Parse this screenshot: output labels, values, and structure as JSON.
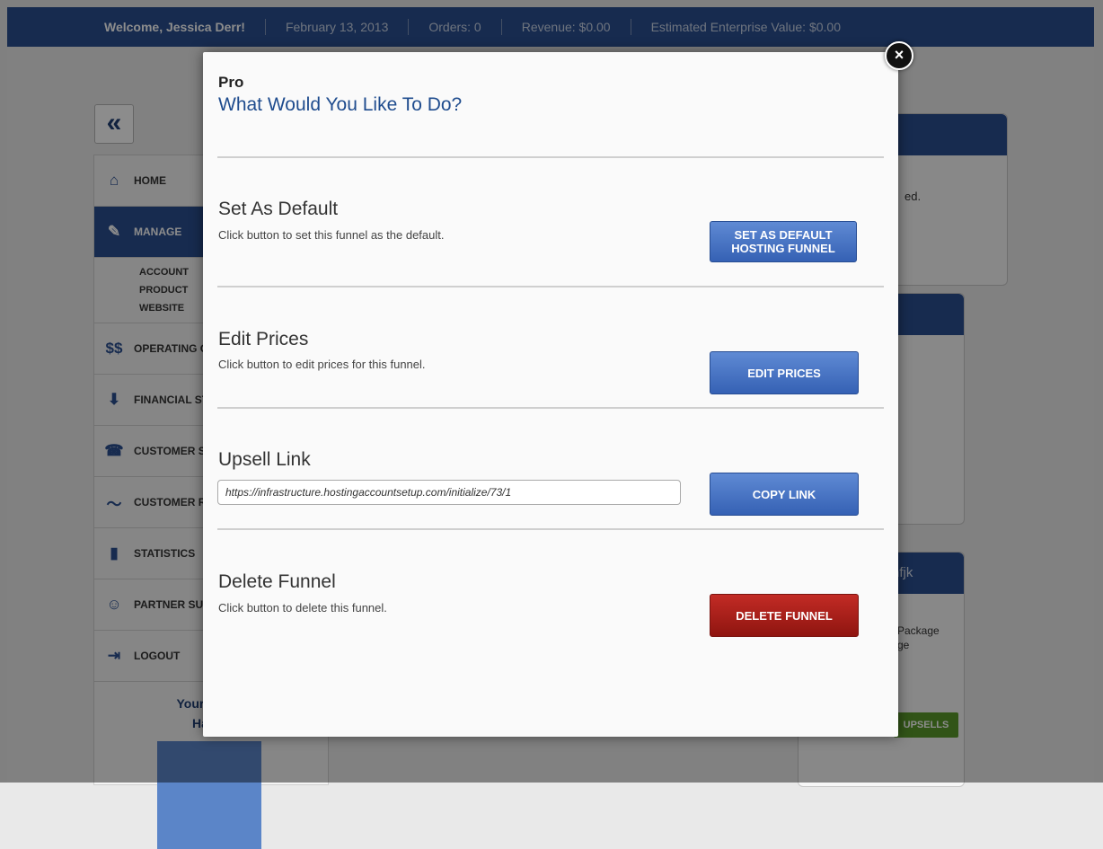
{
  "topbar": {
    "welcome": "Welcome, Jessica Derr!",
    "date": "February 13, 2013",
    "orders": "Orders: 0",
    "revenue": "Revenue: $0.00",
    "ev": "Estimated Enterprise Value: $0.00"
  },
  "sidebar": {
    "collapse": "«",
    "items": [
      {
        "label": "HOME",
        "icon": "home-icon",
        "glyph": "⌂"
      },
      {
        "label": "MANAGE",
        "icon": "wrench-icon",
        "glyph": "✎"
      },
      {
        "label": "OPERATING C",
        "icon": "dollar-icon",
        "glyph": "$$"
      },
      {
        "label": "FINANCIAL ST",
        "icon": "tray-icon",
        "glyph": "⬇"
      },
      {
        "label": "CUSTOMER SU",
        "icon": "phone-icon",
        "glyph": "☎"
      },
      {
        "label": "CUSTOMER RE",
        "icon": "trend-icon",
        "glyph": "〜"
      },
      {
        "label": "STATISTICS",
        "icon": "bar-chart-icon",
        "glyph": "▮"
      },
      {
        "label": "PARTNER SUP",
        "icon": "people-icon",
        "glyph": "☺"
      },
      {
        "label": "LOGOUT",
        "icon": "logout-icon",
        "glyph": "⇥"
      }
    ],
    "subitems": [
      "ACCOUNT",
      "PRODUCT",
      "WEBSITE"
    ],
    "account_title": "Your Accou",
    "account_name": "Hayde"
  },
  "modal": {
    "subtitle": "Pro",
    "title": "What Would You Like To Do?",
    "close": "×",
    "sections": [
      {
        "title": "Set As Default",
        "desc": "Click button to set this funnel as the default.",
        "button": "SET AS DEFAULT HOSTING FUNNEL"
      },
      {
        "title": "Edit Prices",
        "desc": "Click button to edit prices for this funnel.",
        "button": "EDIT PRICES"
      },
      {
        "title": "Upsell Link",
        "link": "https://infrastructure.hostingaccountsetup.com/initialize/73/1",
        "button": "COPY LINK"
      },
      {
        "title": "Delete Funnel",
        "desc": "Click button to delete this funnel.",
        "button": "DELETE FUNNEL"
      }
    ]
  },
  "bg_fragments": {
    "a": "ed.",
    "b": "nfjk",
    "c": "Package",
    "d": "ge",
    "e": "UPSELLS"
  },
  "colors": {
    "accent": "#2a4f91",
    "button_blue": "#3f6cc0",
    "button_red": "#a8201b"
  }
}
